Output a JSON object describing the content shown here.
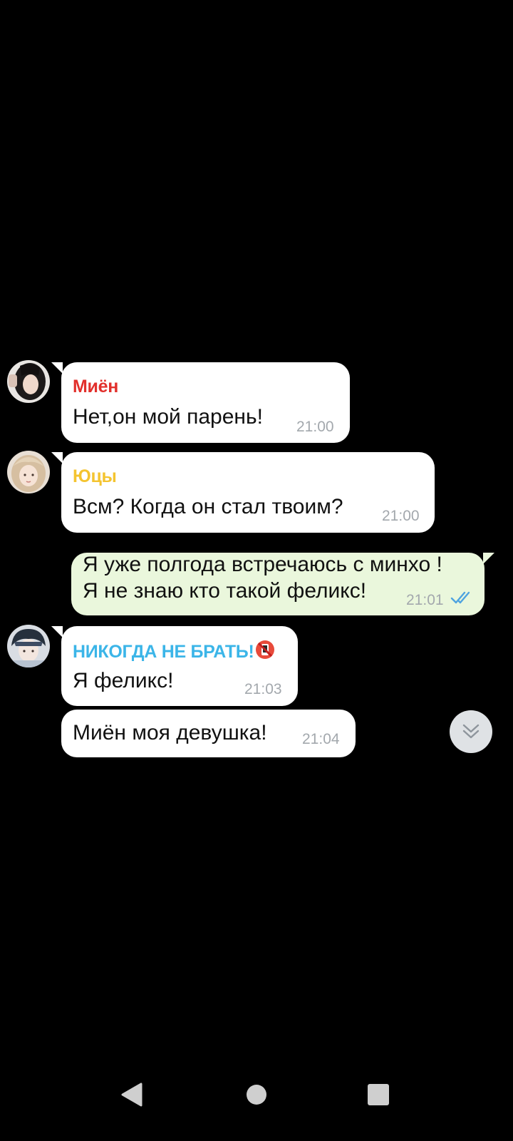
{
  "colors": {
    "background": "#000000",
    "incoming_bubble": "#ffffff",
    "outgoing_bubble": "#eaf7dc",
    "timestamp": "#a3a8ad",
    "read_ticks": "#4fa3e0"
  },
  "messages": [
    {
      "sender": "Миён",
      "sender_color": "#e2302c",
      "text": "Нет,он мой парень!",
      "time": "21:00"
    },
    {
      "sender": "Юцы",
      "sender_color": "#f4c430",
      "text": "Всм? Когда он стал твоим?",
      "time": "21:00"
    },
    {
      "outgoing": true,
      "line1": "Я уже полгода встречаюсь с минхо !",
      "line2": "Я не знаю кто такой феликс!",
      "time": "21:01",
      "status_icon": "double-check-read-icon"
    },
    {
      "sender": "НИКОГДА НЕ БРАТЬ!",
      "sender_color": "#3bb5e8",
      "sender_badge_icon": "no-phone-emoji-icon",
      "text": "Я феликс!",
      "time": "21:03"
    },
    {
      "text": "Миён моя девушка!",
      "time": "21:04"
    }
  ],
  "scroll_button_icon": "double-chevron-down-icon",
  "navigation": {
    "back_icon": "triangle-back-icon",
    "home_icon": "circle-home-icon",
    "recents_icon": "square-recents-icon"
  }
}
